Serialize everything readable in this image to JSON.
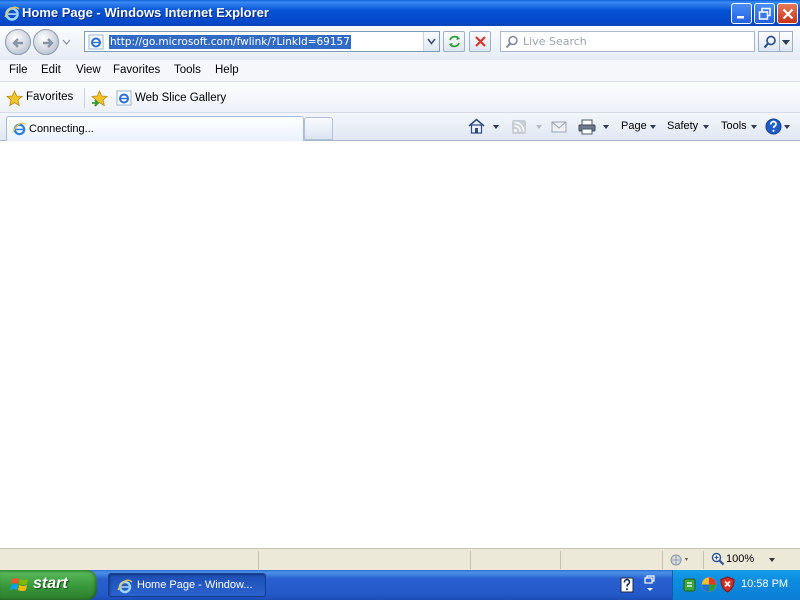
{
  "window": {
    "title": "Home Page - Windows Internet Explorer"
  },
  "address_bar": {
    "url": "http://go.microsoft.com/fwlink/?LinkId=69157"
  },
  "search": {
    "placeholder": "Live Search"
  },
  "menu": {
    "items": [
      "File",
      "Edit",
      "View",
      "Favorites",
      "Tools",
      "Help"
    ]
  },
  "favorites_bar": {
    "favorites_label": "Favorites",
    "web_slice_label": "Web Slice Gallery"
  },
  "tabs": {
    "active_label": "Connecting..."
  },
  "command_bar": {
    "page_label": "Page",
    "safety_label": "Safety",
    "tools_label": "Tools"
  },
  "status_bar": {
    "zoom": "100%"
  },
  "taskbar": {
    "start_label": "start",
    "task_item_label": "Home Page - Window...",
    "clock": "10:58 PM"
  },
  "colors": {
    "titlebar_blue": "#0553d6",
    "selection_blue": "#316ac5",
    "start_green": "#37983a",
    "taskbar_blue": "#245ac8",
    "close_red": "#c5331a"
  }
}
